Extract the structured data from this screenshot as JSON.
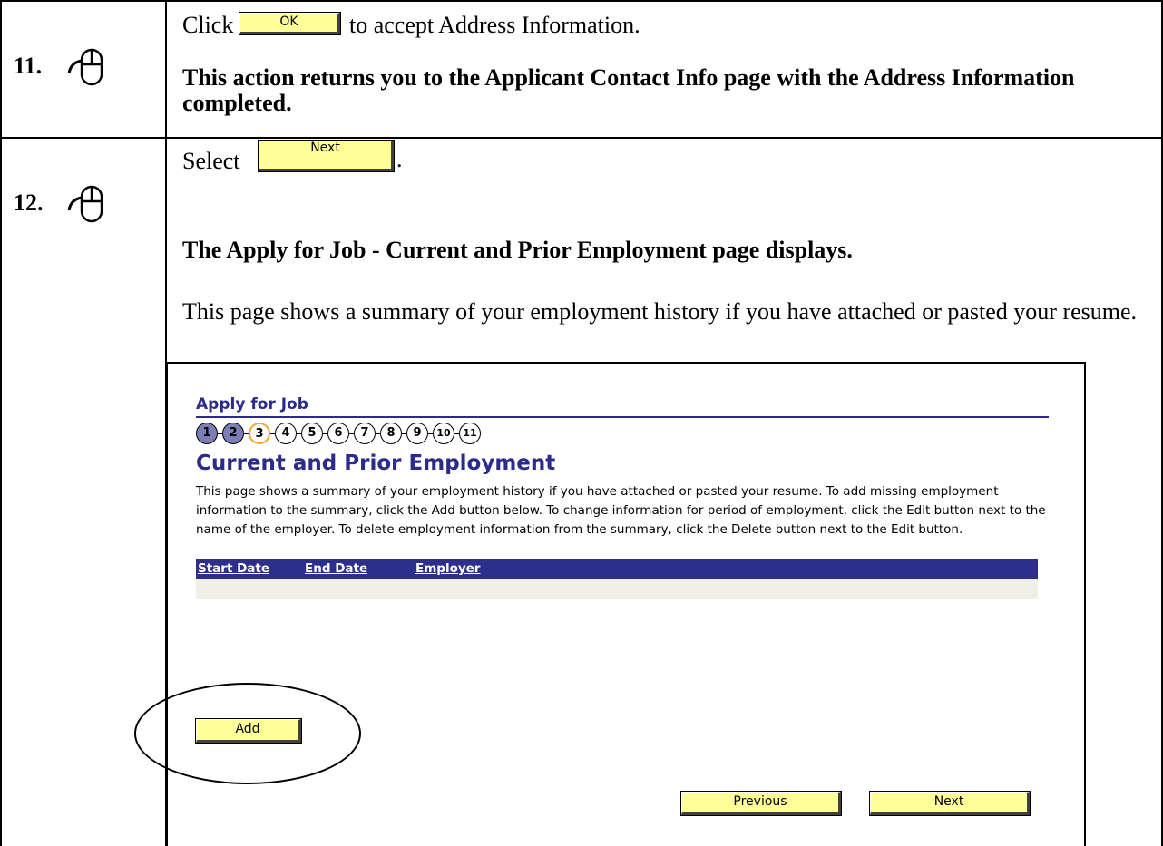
{
  "steps": [
    {
      "number": "11.",
      "line1_before": "Click",
      "button_label": "OK",
      "line1_after": "to accept Address Information.",
      "result_text": "This action returns you to the Applicant Contact Info page with the Address Information completed."
    },
    {
      "number": "12.",
      "line1_before": "Select",
      "button_label": "Next",
      "line1_after": ".",
      "result_text": "The Apply for Job - Current and Prior Employment page displays.",
      "note_text": "This page shows a summary of your employment history if you have attached or pasted your resume."
    }
  ],
  "screenshot": {
    "header": "Apply for Job",
    "progress_steps": [
      "1",
      "2",
      "3",
      "4",
      "5",
      "6",
      "7",
      "8",
      "9",
      "10",
      "11"
    ],
    "completed_steps": 2,
    "current_step": 3,
    "page_title": "Current and Prior Employment",
    "description": "This page shows a summary of your employment history if you have attached or pasted your resume. To add missing employment information to the summary, click the Add button below. To change information for period of employment, click the Edit button next to the name of the employer. To delete employment information from the summary, click the Delete button next to the Edit button.",
    "table_headers": [
      "Start Date",
      "End Date",
      "Employer"
    ],
    "buttons": {
      "add": "Add",
      "previous": "Previous",
      "next": "Next"
    },
    "colors": {
      "header_blue": "#2b2b8b",
      "button_yellow": "#ffff9a",
      "completed_step": "#7c7fb6",
      "current_step_ring": "#f0a830"
    }
  },
  "icons": [
    "mouse-click-icon"
  ]
}
